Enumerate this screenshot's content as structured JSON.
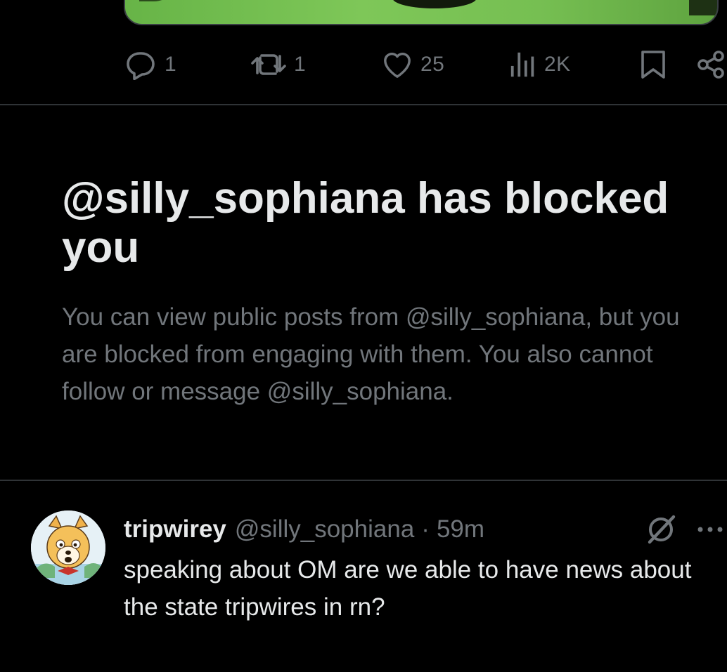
{
  "post_actions": {
    "reply_count": "1",
    "repost_count": "1",
    "like_count": "25",
    "view_count": "2K",
    "icons": {
      "reply": "reply-icon",
      "repost": "repost-icon",
      "like": "heart-icon",
      "views": "views-icon",
      "bookmark": "bookmark-icon",
      "share": "share-icon"
    }
  },
  "blocked_notice": {
    "title": "@silly_sophiana has blocked you",
    "body": "You can view public posts from @silly_sophiana, but you are blocked from engaging with them. You also cannot follow or message @silly_sophiana."
  },
  "reply": {
    "display_name": "tripwirey",
    "handle": "@silly_sophiana",
    "separator": "·",
    "time": "59m",
    "text": "speaking about OM are we able to have news about the state tripwires in rn?"
  },
  "colors": {
    "background": "#000000",
    "primary_text": "#e7e9ea",
    "secondary_text": "#71767b",
    "divider": "#2f3336"
  }
}
